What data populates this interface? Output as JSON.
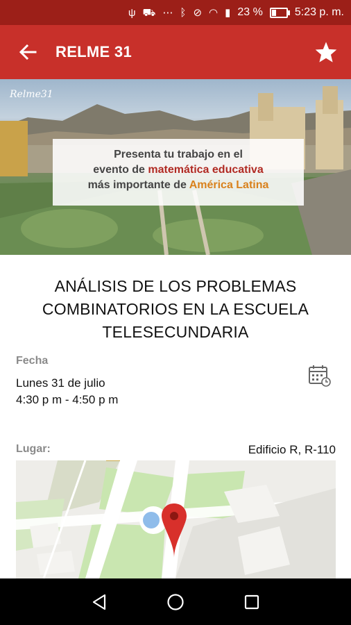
{
  "status_bar": {
    "icons": [
      "usb-icon",
      "car-icon",
      "more-icon",
      "bluetooth-icon",
      "mute-icon",
      "wifi-icon",
      "sim-icon",
      "battery-icon"
    ],
    "battery": "23 %",
    "time": "5:23 p. m."
  },
  "app_bar": {
    "title": "RELME 31",
    "back_icon": "arrow-back-icon",
    "favorite_icon": "star-icon",
    "color": "#c8302a"
  },
  "banner": {
    "logo_text": "Relme31",
    "tagline_line1": "Presenta tu trabajo en el",
    "tagline_line2_pre": "evento de ",
    "tagline_line2_em": "matemática educativa",
    "tagline_line3_pre": "más importante de ",
    "tagline_line3_em": "América Latina"
  },
  "session": {
    "title": "ANÁLISIS DE LOS PROBLEMAS COMBINATORIOS EN LA ESCUELA TELESECUNDARIA",
    "date_label": "Fecha",
    "date": "Lunes 31 de julio",
    "time": "4:30 p m - 4:50 p m",
    "calendar_icon": "calendar-add-icon",
    "place_label": "Lugar:",
    "place": "Edificio R, R-110"
  },
  "map": {
    "marker_icon": "map-pin-icon"
  },
  "nav_bar": {
    "icons": [
      "back-triangle-icon",
      "home-circle-icon",
      "recents-square-icon"
    ]
  }
}
